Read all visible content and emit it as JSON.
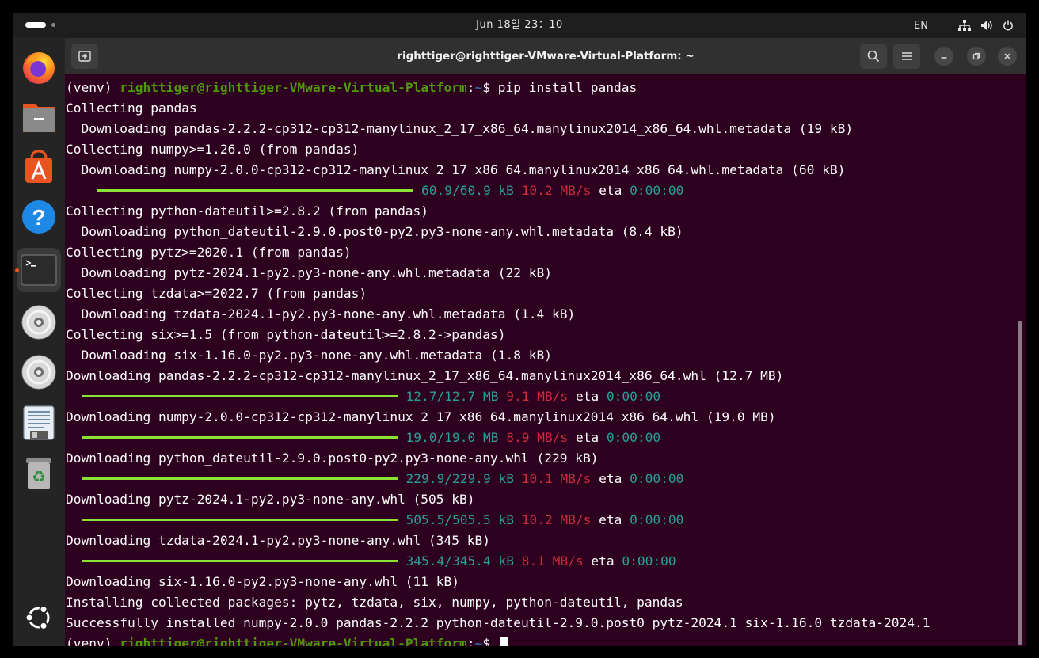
{
  "topbar": {
    "clock": "Jun 18일 23：10",
    "language": "EN"
  },
  "dock": {
    "apps": [
      {
        "name": "firefox",
        "icon": "firefox-icon"
      },
      {
        "name": "files",
        "icon": "files-icon"
      },
      {
        "name": "app-center",
        "icon": "app-center-icon"
      },
      {
        "name": "help",
        "icon": "help-icon",
        "glyph": "?"
      },
      {
        "name": "terminal",
        "icon": "terminal-icon",
        "glyph": ">_",
        "running": true
      },
      {
        "name": "disc-1",
        "icon": "disc-icon"
      },
      {
        "name": "disc-2",
        "icon": "disc-icon"
      },
      {
        "name": "text-editor",
        "icon": "text-editor-icon"
      },
      {
        "name": "trash",
        "icon": "trash-icon",
        "glyph": "♻"
      }
    ],
    "show_apps_icon": "ubuntu-logo-icon"
  },
  "window": {
    "title": "righttiger@righttiger-VMware-Virtual-Platform: ~"
  },
  "terminal": {
    "prompt": {
      "venv": "(venv) ",
      "userhost": "righttiger@righttiger-VMware-Virtual-Platform",
      "colon": ":",
      "path": "~",
      "dollar": "$ ",
      "command": "pip install pandas"
    },
    "lines": [
      "Collecting pandas",
      "  Downloading pandas-2.2.2-cp312-cp312-manylinux_2_17_x86_64.manylinux2014_x86_64.whl.metadata (19 kB)",
      "Collecting numpy>=1.26.0 (from pandas)",
      "  Downloading numpy-2.0.0-cp312-cp312-manylinux_2_17_x86_64.manylinux2014_x86_64.whl.metadata (60 kB)",
      "",
      "Collecting python-dateutil>=2.8.2 (from pandas)",
      "  Downloading python_dateutil-2.9.0.post0-py2.py3-none-any.whl.metadata (8.4 kB)",
      "Collecting pytz>=2020.1 (from pandas)",
      "  Downloading pytz-2024.1-py2.py3-none-any.whl.metadata (22 kB)",
      "Collecting tzdata>=2022.7 (from pandas)",
      "  Downloading tzdata-2024.1-py2.py3-none-any.whl.metadata (1.4 kB)",
      "Collecting six>=1.5 (from python-dateutil>=2.8.2->pandas)",
      "  Downloading six-1.16.0-py2.py3-none-any.whl.metadata (1.8 kB)",
      "Downloading pandas-2.2.2-cp312-cp312-manylinux_2_17_x86_64.manylinux2014_x86_64.whl (12.7 MB)",
      "",
      "Downloading numpy-2.0.0-cp312-cp312-manylinux_2_17_x86_64.manylinux2014_x86_64.whl (19.0 MB)",
      "",
      "Downloading python_dateutil-2.9.0.post0-py2.py3-none-any.whl (229 kB)",
      "",
      "Downloading pytz-2024.1-py2.py3-none-any.whl (505 kB)",
      "",
      "Downloading tzdata-2024.1-py2.py3-none-any.whl (345 kB)",
      "",
      "Downloading six-1.16.0-py2.py3-none-any.whl (11 kB)",
      "Installing collected packages: pytz, tzdata, six, numpy, python-dateutil, pandas",
      "Successfully installed numpy-2.0.0 pandas-2.2.2 python-dateutil-2.9.0.post0 pytz-2024.1 six-1.16.0 tzdata-2024.1"
    ],
    "progress": [
      {
        "after_line": 4,
        "indent": 3,
        "fraction": 1.0,
        "size": "60.9/60.9 kB",
        "speed": "10.2 MB/s",
        "eta_label": "eta",
        "eta": "0:00:00"
      },
      {
        "after_line": 14,
        "indent": 1,
        "fraction": 1.0,
        "size": "12.7/12.7 MB",
        "speed": "9.1 MB/s",
        "eta_label": "eta",
        "eta": "0:00:00"
      },
      {
        "after_line": 16,
        "indent": 1,
        "fraction": 1.0,
        "size": "19.0/19.0 MB",
        "speed": "8.9 MB/s",
        "eta_label": "eta",
        "eta": "0:00:00"
      },
      {
        "after_line": 18,
        "indent": 1,
        "fraction": 1.0,
        "size": "229.9/229.9 kB",
        "speed": "10.1 MB/s",
        "eta_label": "eta",
        "eta": "0:00:00"
      },
      {
        "after_line": 20,
        "indent": 1,
        "fraction": 1.0,
        "size": "505.5/505.5 kB",
        "speed": "10.2 MB/s",
        "eta_label": "eta",
        "eta": "0:00:00"
      },
      {
        "after_line": 22,
        "indent": 1,
        "fraction": 1.0,
        "size": "345.4/345.4 kB",
        "speed": "8.1 MB/s",
        "eta_label": "eta",
        "eta": "0:00:00"
      }
    ],
    "final_prompt": {
      "venv": "(venv) ",
      "userhost": "righttiger@righttiger-VMware-Virtual-Platform",
      "colon": ":",
      "path": "~",
      "dollar": "$ "
    }
  },
  "colors": {
    "terminal_bg": "#2c001e",
    "prompt_user": "#4e9a06",
    "prompt_path": "#3465a4",
    "progress_bar": "#8ae234",
    "progress_size": "#2aa198",
    "progress_speed": "#cc2b3a",
    "accent": "#e95420"
  }
}
